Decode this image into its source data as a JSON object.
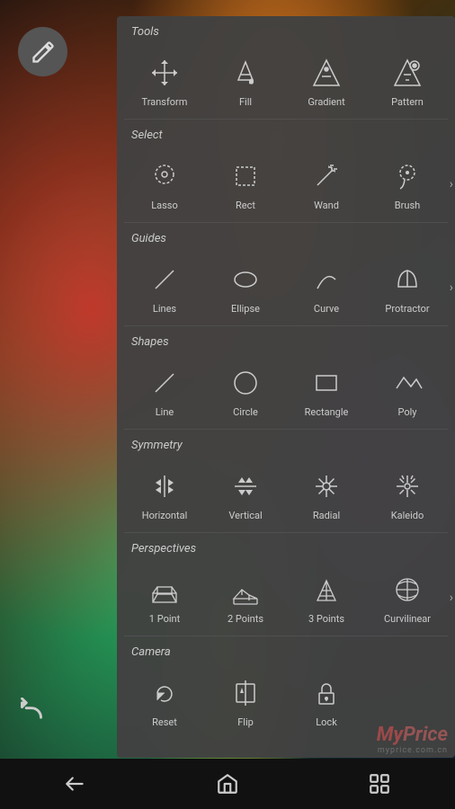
{
  "panel": {
    "title": "Tools",
    "sections": [
      {
        "label": "Tools",
        "showLabel": false,
        "items": [
          {
            "id": "transform",
            "label": "Transform",
            "icon": "move"
          },
          {
            "id": "fill",
            "label": "Fill",
            "icon": "fill"
          },
          {
            "id": "gradient",
            "label": "Gradient",
            "icon": "gradient"
          },
          {
            "id": "pattern",
            "label": "Pattern",
            "icon": "pattern"
          }
        ],
        "hasChevron": false
      },
      {
        "label": "Select",
        "items": [
          {
            "id": "lasso",
            "label": "Lasso",
            "icon": "lasso"
          },
          {
            "id": "rect",
            "label": "Rect",
            "icon": "rect"
          },
          {
            "id": "wand",
            "label": "Wand",
            "icon": "wand"
          },
          {
            "id": "brush",
            "label": "Brush",
            "icon": "brush-select"
          }
        ],
        "hasChevron": true
      },
      {
        "label": "Guides",
        "items": [
          {
            "id": "lines",
            "label": "Lines",
            "icon": "lines"
          },
          {
            "id": "ellipse",
            "label": "Ellipse",
            "icon": "ellipse"
          },
          {
            "id": "curve",
            "label": "Curve",
            "icon": "curve"
          },
          {
            "id": "protractor",
            "label": "Protractor",
            "icon": "protractor"
          }
        ],
        "hasChevron": true
      },
      {
        "label": "Shapes",
        "items": [
          {
            "id": "line",
            "label": "Line",
            "icon": "line"
          },
          {
            "id": "circle",
            "label": "Circle",
            "icon": "circle"
          },
          {
            "id": "rectangle",
            "label": "Rectangle",
            "icon": "rectangle"
          },
          {
            "id": "poly",
            "label": "Poly",
            "icon": "poly"
          }
        ],
        "hasChevron": false
      },
      {
        "label": "Symmetry",
        "items": [
          {
            "id": "horizontal",
            "label": "Horizontal",
            "icon": "horizontal"
          },
          {
            "id": "vertical",
            "label": "Vertical",
            "icon": "vertical"
          },
          {
            "id": "radial",
            "label": "Radial",
            "icon": "radial"
          },
          {
            "id": "kaleido",
            "label": "Kaleido",
            "icon": "kaleido"
          }
        ],
        "hasChevron": false
      },
      {
        "label": "Perspectives",
        "items": [
          {
            "id": "1point",
            "label": "1 Point",
            "icon": "1point"
          },
          {
            "id": "2points",
            "label": "2 Points",
            "icon": "2points"
          },
          {
            "id": "3points",
            "label": "3 Points",
            "icon": "3points"
          },
          {
            "id": "curvilinear",
            "label": "Curvilinear",
            "icon": "curvilinear"
          }
        ],
        "hasChevron": true
      },
      {
        "label": "Camera",
        "items": [
          {
            "id": "reset",
            "label": "Reset",
            "icon": "reset"
          },
          {
            "id": "flip",
            "label": "Flip",
            "icon": "flip"
          },
          {
            "id": "lock",
            "label": "Lock",
            "icon": "lock"
          }
        ],
        "hasChevron": false
      }
    ]
  },
  "nav": {
    "back_label": "back",
    "home_label": "home",
    "recents_label": "recents"
  },
  "watermark": {
    "brand": "MyPrice",
    "url": "myprice.com.cn"
  }
}
